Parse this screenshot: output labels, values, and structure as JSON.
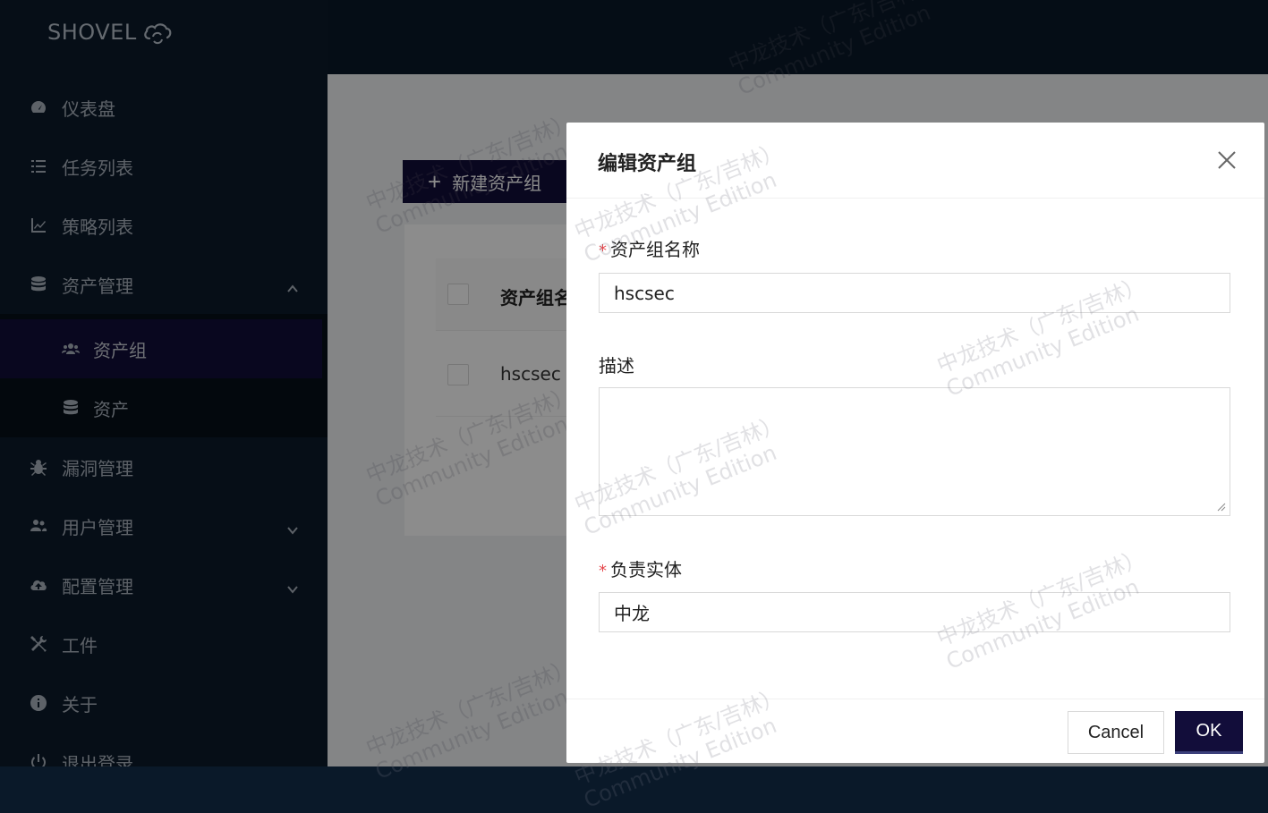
{
  "app": {
    "logo_text": "SHOVEL"
  },
  "sidebar": {
    "items": [
      {
        "label": "仪表盘",
        "icon": "dashboard-icon"
      },
      {
        "label": "任务列表",
        "icon": "task-list-icon"
      },
      {
        "label": "策略列表",
        "icon": "chart-line-icon"
      },
      {
        "label": "资产管理",
        "icon": "database-icon",
        "expanded": true,
        "children": [
          {
            "label": "资产组",
            "icon": "users-icon",
            "active": true
          },
          {
            "label": "资产",
            "icon": "database-icon"
          }
        ]
      },
      {
        "label": "漏洞管理",
        "icon": "bug-icon"
      },
      {
        "label": "用户管理",
        "icon": "user-group-icon",
        "expanded": false
      },
      {
        "label": "配置管理",
        "icon": "cloud-upload-icon",
        "expanded": false
      },
      {
        "label": "工件",
        "icon": "tools-icon"
      },
      {
        "label": "关于",
        "icon": "info-icon"
      },
      {
        "label": "退出登录",
        "icon": "power-icon"
      }
    ]
  },
  "main": {
    "new_button_label": "新建资产组",
    "table": {
      "header": "资产组名",
      "rows": [
        {
          "name": "hscsec"
        }
      ]
    }
  },
  "modal": {
    "title": "编辑资产组",
    "fields": {
      "name": {
        "label": "资产组名称",
        "required": true,
        "value": "hscsec"
      },
      "description": {
        "label": "描述",
        "required": false,
        "value": ""
      },
      "owner": {
        "label": "负责实体",
        "required": true,
        "value": "中龙"
      }
    },
    "cancel_label": "Cancel",
    "ok_label": "OK"
  },
  "watermark": {
    "line1": "中龙技术（广东/吉林）",
    "line2": "Community Edition"
  },
  "colors": {
    "sidebar_bg": "#0b1a2b",
    "accent": "#120d3a",
    "required": "#e5484d"
  }
}
